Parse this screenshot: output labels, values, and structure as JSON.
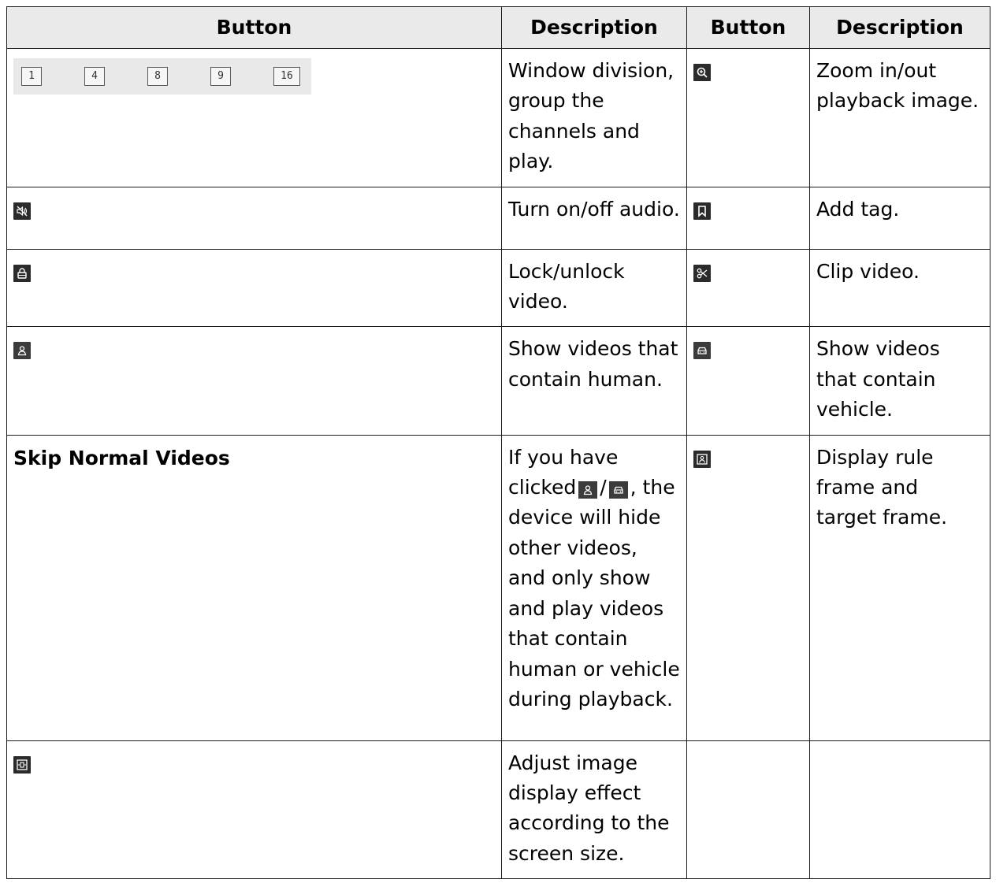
{
  "headers": {
    "button_1": "Button",
    "description_1": "Description",
    "button_2": "Button",
    "description_2": "Description"
  },
  "window_division": {
    "options": [
      "1",
      "4",
      "8",
      "9",
      "16"
    ]
  },
  "rows": [
    {
      "left_icon": "window-division-buttons",
      "left_description": "Window division, group the channels and play.",
      "right_icon": "zoom-in-icon",
      "right_description": "Zoom in/out playback image."
    },
    {
      "left_icon": "audio-mute-icon",
      "left_description": "Turn on/off audio.",
      "right_icon": "bookmark-icon",
      "right_description": "Add tag."
    },
    {
      "left_icon": "lock-icon",
      "left_description": "Lock/unlock video.",
      "right_icon": "scissors-icon",
      "right_description": "Clip video."
    },
    {
      "left_icon": "human-icon",
      "left_description": "Show videos that contain human.",
      "right_icon": "vehicle-icon",
      "right_description": "Show videos that contain vehicle."
    },
    {
      "left_label": "Skip Normal Videos",
      "left_description_before": "If you have clicked",
      "left_description_sep": "/",
      "left_description_after": ", the device will hide other videos, and only show and play videos that contain human or vehicle during playback.",
      "right_icon": "rule-frame-icon",
      "right_description": "Display rule frame and target frame."
    },
    {
      "left_icon": "fit-screen-icon",
      "left_description": "Adjust image display effect according to the screen size.",
      "right_icon": "",
      "right_description": ""
    }
  ],
  "colors": {
    "icon_background": "#2b2b2b",
    "header_background": "#eaeaea",
    "border": "#1a1a1a"
  }
}
